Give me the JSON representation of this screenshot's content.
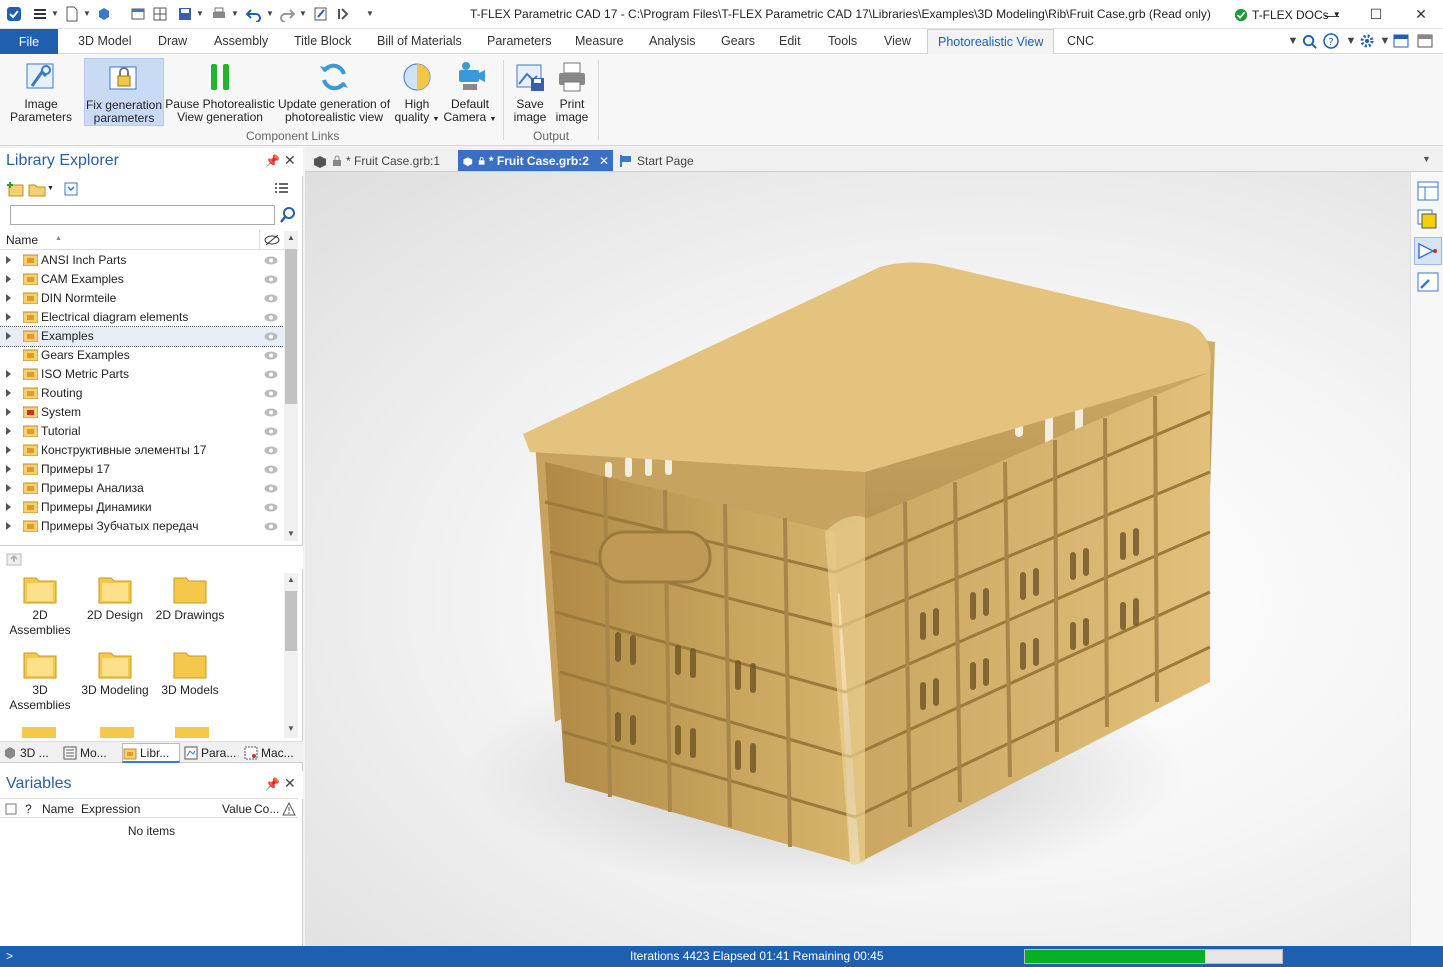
{
  "window": {
    "title": "T-FLEX Parametric CAD 17 - C:\\Program Files\\T-FLEX Parametric CAD 17\\Libraries\\Examples\\3D Modeling\\Rib\\Fruit Case.grb (Read only)",
    "docs_label": "T-FLEX DOCs"
  },
  "menu": {
    "file": "File",
    "tabs": [
      "3D Model",
      "Draw",
      "Assembly",
      "Title Block",
      "Bill of Materials",
      "Parameters",
      "Measure",
      "Analysis",
      "Gears",
      "Edit",
      "Tools",
      "View",
      "Photorealistic View",
      "CNC"
    ],
    "active_tab": "Photorealistic View"
  },
  "ribbon": {
    "buttons": [
      {
        "label_1": "Image",
        "label_2": "Parameters"
      },
      {
        "label_1": "Fix generation",
        "label_2": "parameters"
      },
      {
        "label_1": "Pause Photorealistic",
        "label_2": "View generation"
      },
      {
        "label_1": "Update generation of",
        "label_2": "photorealistic view"
      },
      {
        "label_1": "High",
        "label_2": "quality"
      },
      {
        "label_1": "Default",
        "label_2": "Camera"
      },
      {
        "label_1": "Save",
        "label_2": "image"
      },
      {
        "label_1": "Print",
        "label_2": "image"
      }
    ],
    "groups": {
      "component_links": "Component Links",
      "output": "Output"
    }
  },
  "library": {
    "title": "Library Explorer",
    "search_value": "",
    "name_header": "Name",
    "items": [
      "ANSI Inch Parts",
      "CAM Examples",
      "DIN Normteile",
      "Electrical diagram elements",
      "Examples",
      "Gears Examples",
      "ISO Metric Parts",
      "Routing",
      "System",
      "Tutorial",
      "Конструктивные элементы 17",
      "Примеры 17",
      "Примеры Анализа",
      "Примеры Динамики",
      "Примеры Зубчатых передач"
    ],
    "selected": "Examples",
    "folders": [
      {
        "l1": "2D",
        "l2": "Assemblies"
      },
      {
        "l1": "2D Design",
        "l2": ""
      },
      {
        "l1": "2D Drawings",
        "l2": ""
      },
      {
        "l1": "3D",
        "l2": "Assemblies"
      },
      {
        "l1": "3D Modeling",
        "l2": ""
      },
      {
        "l1": "3D Models",
        "l2": ""
      }
    ]
  },
  "panel_tabs": [
    "3D ...",
    "Mo...",
    "Libr...",
    "Para...",
    "Mac..."
  ],
  "variables": {
    "title": "Variables",
    "cols": {
      "q": "?",
      "name": "Name",
      "expr": "Expression",
      "value": "Value",
      "comment": "Co..."
    },
    "empty": "No items"
  },
  "doc_tabs": [
    "* Fruit Case.grb:1",
    "* Fruit Case.grb:2",
    "Start Page"
  ],
  "status": {
    "text": "Iterations 4423 Elapsed 01:41 Remaining 00:45",
    "progress_fraction": 0.7,
    "prompt": ">"
  },
  "colors": {
    "accent": "#1f5fb0",
    "product": "#d6b46c",
    "progress": "#06b025"
  }
}
